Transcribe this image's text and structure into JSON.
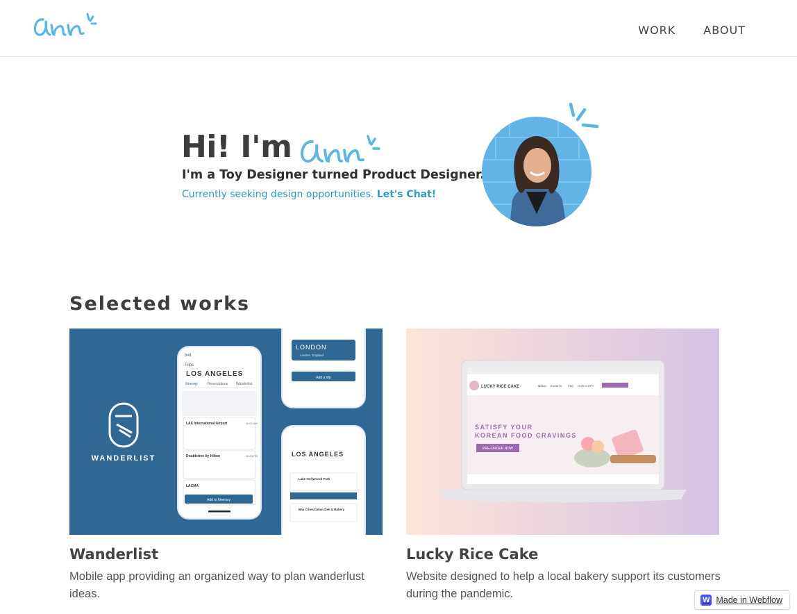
{
  "header": {
    "logo_alt": "Ann",
    "nav": [
      {
        "label": "WORK"
      },
      {
        "label": "ABOUT"
      }
    ]
  },
  "hero": {
    "greeting": "Hi! I'm",
    "subtitle": "I'm a Toy Designer turned Product Designer.",
    "cta_text": "Currently seeking design opportunities. ",
    "cta_link": "Let's Chat!"
  },
  "works": {
    "title": "Selected works",
    "items": [
      {
        "title": "Wanderlist",
        "description": "Mobile app providing an organized way to plan wanderlust ideas.",
        "thumb": {
          "brand": "WANDERLIST",
          "phone1_header": "Trips",
          "phone1_city": "LOS ANGELES",
          "phone1_tabs": [
            "Itinerary",
            "Reservations",
            "Wanderlist"
          ],
          "phone1_items": [
            {
              "title": "LAX International Airport",
              "time": "11:00 AM"
            },
            {
              "title": "Doubletree by Hilton",
              "time": "12:00 PM"
            },
            {
              "title": "LACMA",
              "time": ""
            }
          ],
          "phone1_button": "Add to Itinerary",
          "phone2_city": "LONDON",
          "phone2_sub": "London, England",
          "phone2_button": "Add a trip",
          "phone3_city": "LOS ANGELES",
          "phone3_items": [
            {
              "title": "Lake Hollywood Park"
            },
            {
              "title": "Bay Cities Italian Deli & Bakery"
            }
          ]
        }
      },
      {
        "title": "Lucky Rice Cake",
        "description": "Website designed to help a local bakery support its customers during the pandemic.",
        "thumb": {
          "site_name": "LUCKY RICE CAKE",
          "headline_1": "SATISFY YOUR",
          "headline_2": "KOREAN FOOD CRAVINGS",
          "button": "PRE-ORDER NOW",
          "menu": [
            "MENU",
            "EVENTS",
            "FAQ",
            "OUR STORY"
          ]
        }
      }
    ]
  },
  "badge": {
    "label": "Made in Webflow"
  },
  "colors": {
    "accent_blue": "#2d9ac9",
    "wanderlist_bg": "#2f6894",
    "lucky_purple": "#9b6bb0"
  }
}
